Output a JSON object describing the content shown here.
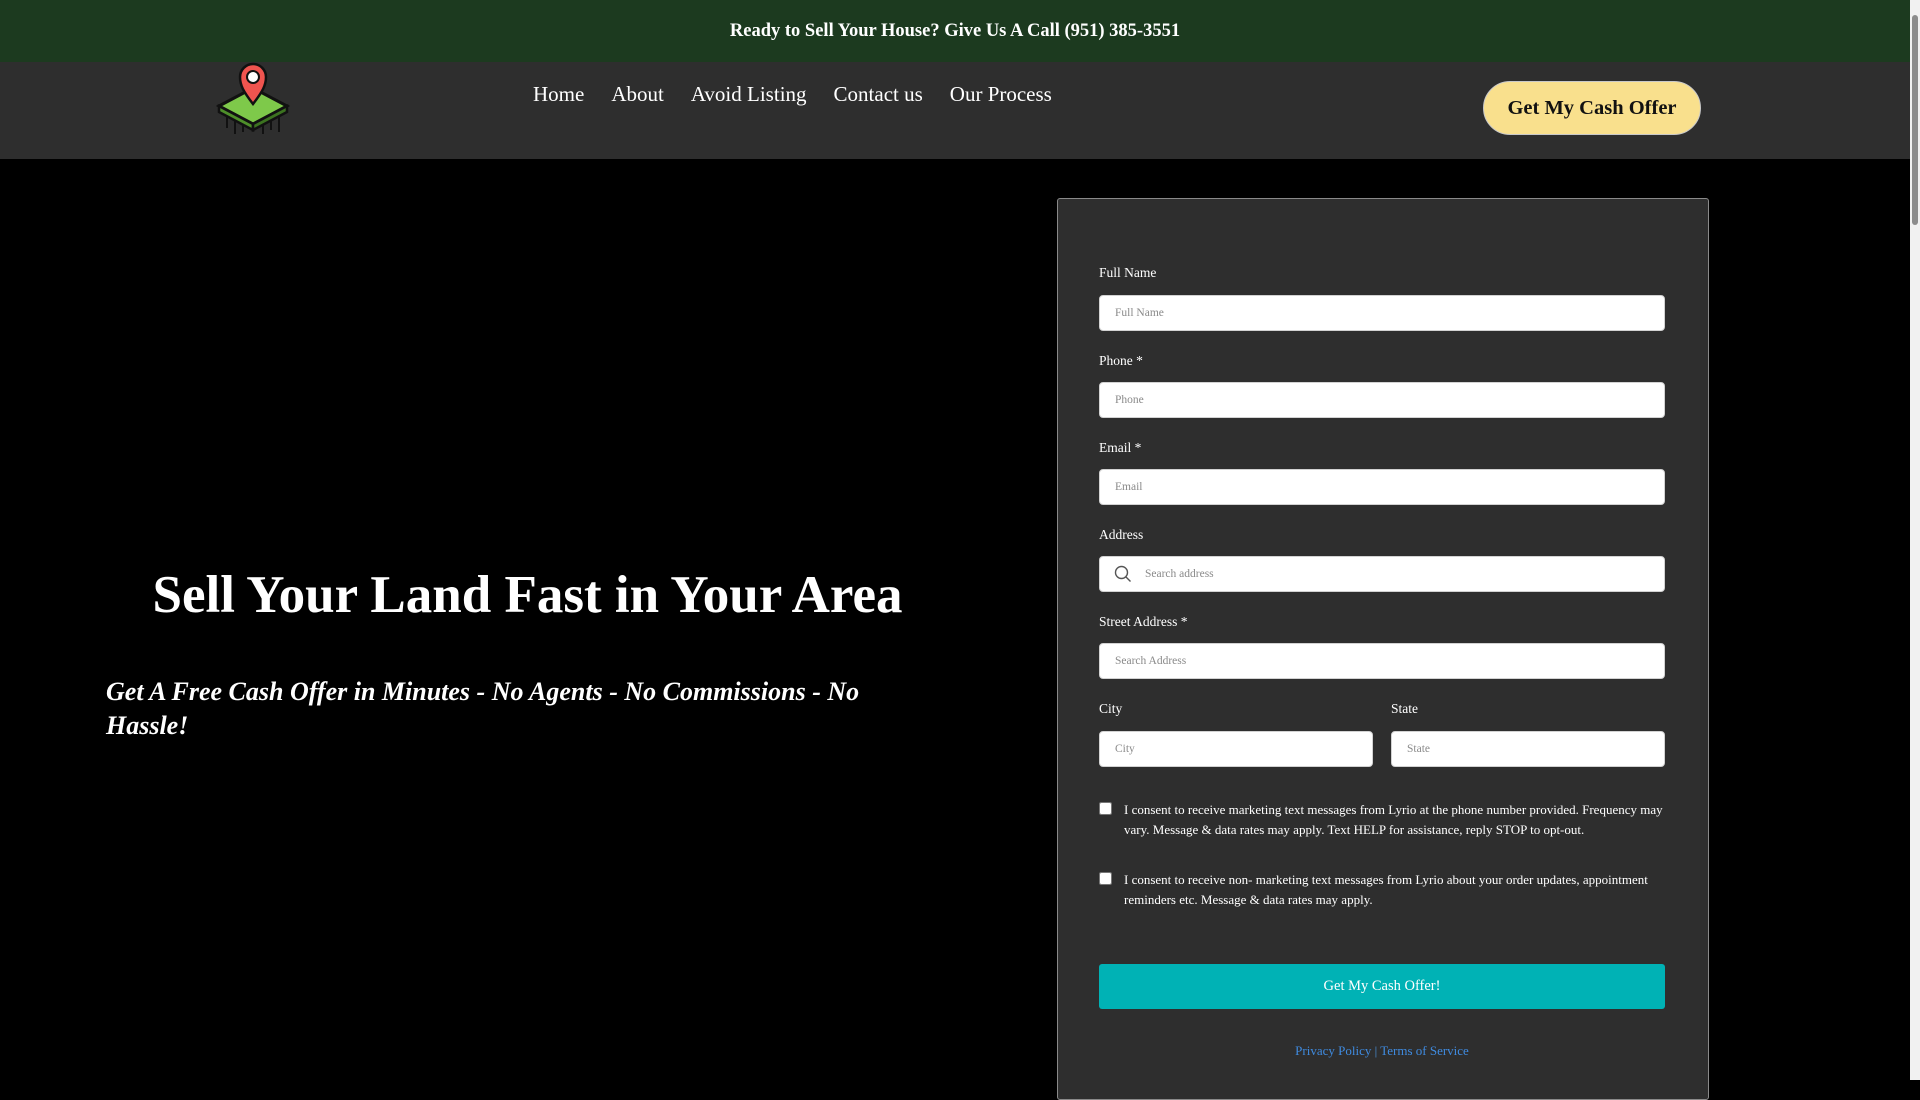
{
  "topbar": {
    "text": "Ready to Sell Your House? Give Us A Call (951) 385-3551"
  },
  "logo": {
    "icon": "map-pin-land-logo"
  },
  "nav": {
    "links": [
      "Home",
      "About",
      "Avoid Listing",
      "Contact us",
      "Our Process"
    ],
    "cta": "Get My Cash Offer"
  },
  "hero": {
    "title": "Sell Your Land Fast in Your Area",
    "subtitle": "Get A Free Cash Offer in Minutes - No Agents - No Commissions - No Hassle!"
  },
  "form": {
    "full_name": {
      "label": "Full Name",
      "placeholder": "Full Name"
    },
    "phone": {
      "label": "Phone *",
      "placeholder": "Phone"
    },
    "email": {
      "label": "Email *",
      "placeholder": "Email"
    },
    "address": {
      "label": "Address",
      "placeholder": "Search address",
      "icon": "search-icon"
    },
    "street": {
      "label": "Street Address *",
      "placeholder": "Search Address"
    },
    "city": {
      "label": "City",
      "placeholder": "City"
    },
    "state": {
      "label": "State",
      "placeholder": "State"
    },
    "consent_marketing": "I consent to receive marketing text messages from Lyrio at the phone number provided. Frequency may vary. Message & data rates may apply. Text HELP for assistance, reply STOP to opt-out.",
    "consent_non_marketing": "I consent to receive non- marketing text messages from Lyrio about your order updates, appointment reminders etc. Message & data rates may apply.",
    "submit": "Get My Cash Offer!",
    "privacy": "Privacy Policy",
    "separator": "|",
    "terms": "Terms of Service"
  },
  "colors": {
    "topbar": "#1c3a1f",
    "navbar": "#2e2e2e",
    "cta": "#f9e08d",
    "submit": "#00b2b5",
    "link": "#3f8be0"
  }
}
